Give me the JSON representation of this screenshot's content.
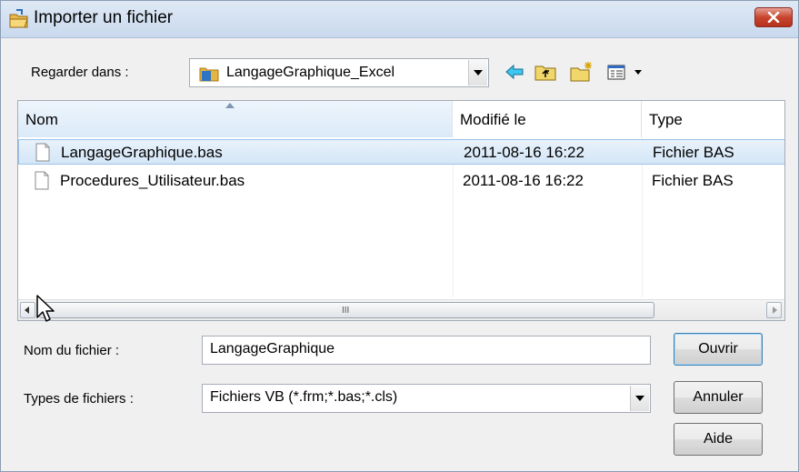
{
  "window": {
    "title": "Importer un fichier"
  },
  "look_in": {
    "label": "Regarder dans :",
    "value": "LangageGraphique_Excel"
  },
  "toolbar": {
    "icons": [
      "back-icon",
      "up-folder-icon",
      "new-folder-icon",
      "view-menu-icon"
    ]
  },
  "file_list": {
    "columns": [
      "Nom",
      "Modifié le",
      "Type"
    ],
    "rows": [
      {
        "name": "LangageGraphique.bas",
        "modified": "2011-08-16 16:22",
        "type": "Fichier BAS",
        "selected": true
      },
      {
        "name": "Procedures_Utilisateur.bas",
        "modified": "2011-08-16 16:22",
        "type": "Fichier BAS",
        "selected": false
      }
    ],
    "scroll_grip": "III"
  },
  "filename": {
    "label": "Nom du fichier :",
    "value": "LangageGraphique"
  },
  "filetype": {
    "label": "Types de fichiers :",
    "value": "Fichiers VB (*.frm;*.bas;*.cls)"
  },
  "buttons": {
    "open": "Ouvrir",
    "cancel": "Annuler",
    "help": "Aide"
  }
}
